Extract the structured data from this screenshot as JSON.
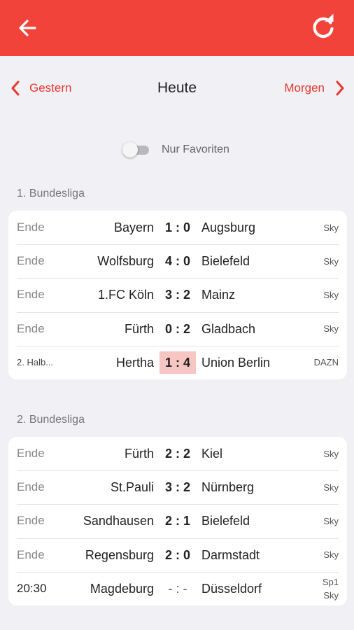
{
  "colors": {
    "accent": "#f2433a",
    "live_score_bg": "#f7c6c3",
    "background": "#f1f0f5"
  },
  "appbar": {
    "back_icon": "arrow-left-icon",
    "refresh_icon": "refresh-icon"
  },
  "daynav": {
    "prev_label": "Gestern",
    "current_label": "Heute",
    "next_label": "Morgen"
  },
  "favorites": {
    "label": "Nur Favoriten",
    "enabled": false
  },
  "leagues": [
    {
      "title": "1. Bundesliga",
      "matches": [
        {
          "status": "Ende",
          "home": "Bayern",
          "score": "1 : 0",
          "away": "Augsburg",
          "tv": [
            "Sky"
          ]
        },
        {
          "status": "Ende",
          "home": "Wolfsburg",
          "score": "4 : 0",
          "away": "Bielefeld",
          "tv": [
            "Sky"
          ]
        },
        {
          "status": "Ende",
          "home": "1.FC Köln",
          "score": "3 : 2",
          "away": "Mainz",
          "tv": [
            "Sky"
          ]
        },
        {
          "status": "Ende",
          "home": "Fürth",
          "score": "0 : 2",
          "away": "Gladbach",
          "tv": [
            "Sky"
          ]
        },
        {
          "status": "2. Halb...",
          "home": "Hertha",
          "score": "1 : 4",
          "away": "Union Berlin",
          "tv": [
            "DAZN"
          ],
          "live": true
        }
      ]
    },
    {
      "title": "2. Bundesliga",
      "matches": [
        {
          "status": "Ende",
          "home": "Fürth",
          "score": "2 : 2",
          "away": "Kiel",
          "tv": [
            "Sky"
          ]
        },
        {
          "status": "Ende",
          "home": "St.Pauli",
          "score": "3 : 2",
          "away": "Nürnberg",
          "tv": [
            "Sky"
          ]
        },
        {
          "status": "Ende",
          "home": "Sandhausen",
          "score": "2 : 1",
          "away": "Bielefeld",
          "tv": [
            "Sky"
          ]
        },
        {
          "status": "Ende",
          "home": "Regensburg",
          "score": "2 : 0",
          "away": "Darmstadt",
          "tv": [
            "Sky"
          ]
        },
        {
          "status": "20:30",
          "home": "Magdeburg",
          "score": "- : -",
          "away": "Düsseldorf",
          "tv": [
            "Sp1",
            "Sky"
          ]
        }
      ]
    }
  ]
}
